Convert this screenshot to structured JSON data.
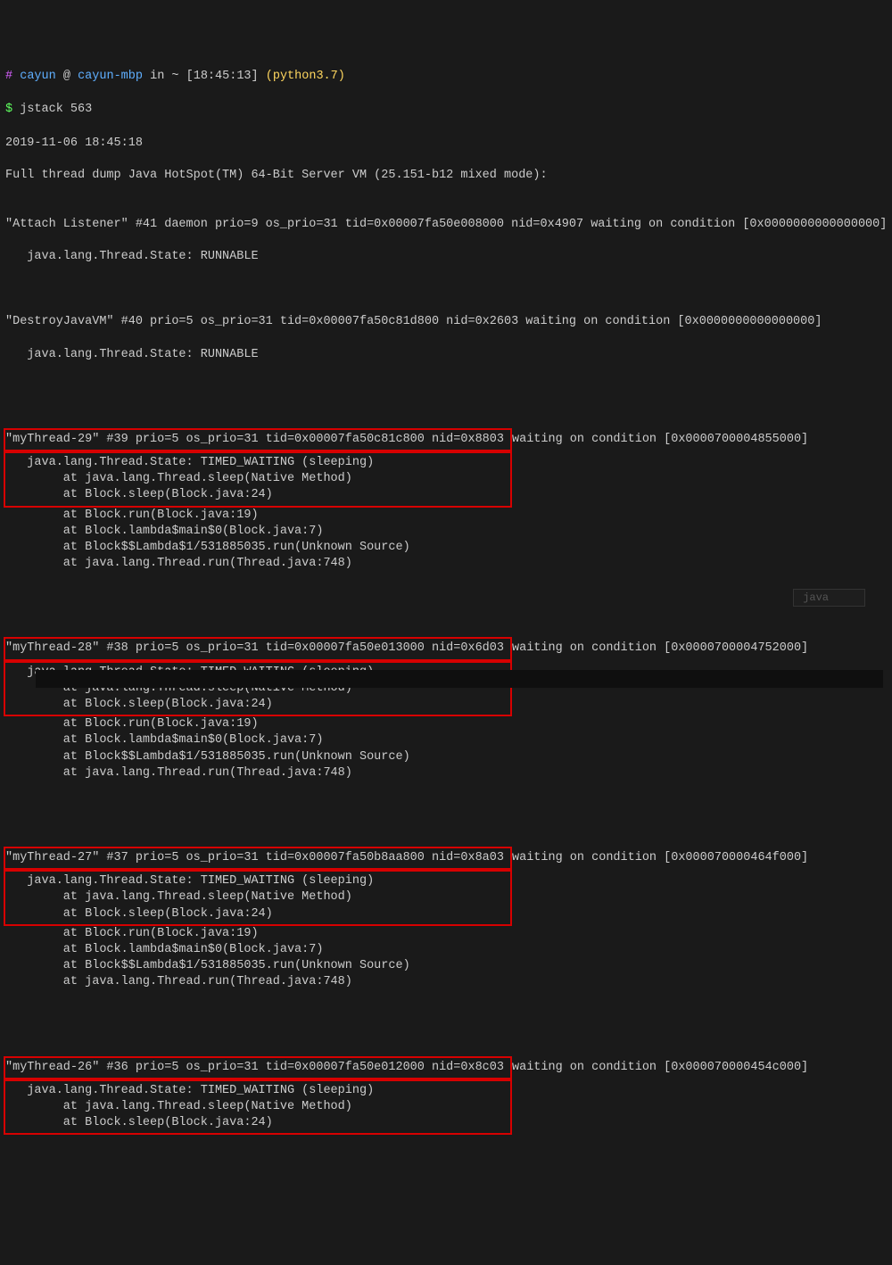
{
  "prompt": {
    "hash": "#",
    "user": "cayun",
    "at": "@",
    "host": "cayun-mbp",
    "in": "in",
    "path": "~",
    "time": "[18:45:13]",
    "python": "(python3.7)"
  },
  "command": {
    "dollar": "$",
    "text": "jstack 563"
  },
  "lines": {
    "l0": "2019-11-06 18:45:18",
    "l1": "Full thread dump Java HotSpot(TM) 64-Bit Server VM (25.151-b12 mixed mode):",
    "blank": "",
    "attach1": "\"Attach Listener\" #41 daemon prio=9 os_prio=31 tid=0x00007fa50e008000 nid=0x4907 waiting on condition [0x0000000000000000]",
    "attach2": "   java.lang.Thread.State: RUNNABLE",
    "destroy1": "\"DestroyJavaVM\" #40 prio=5 os_prio=31 tid=0x00007fa50c81d800 nid=0x2603 waiting on condition [0x0000000000000000]",
    "destroy2": "   java.lang.Thread.State: RUNNABLE",
    "t29_h_a": "\"myThread-29\" #39 prio=5 os_prio=31 tid=0x00007fa50c81c800 nid=0x8803 ",
    "t29_h_b": "waiting on condition [0x0000700004855000]",
    "t29_1": "   java.lang.Thread.State: TIMED_WAITING (sleeping)",
    "t29_2": "        at java.lang.Thread.sleep(Native Method)",
    "t29_3": "        at Block.sleep(Block.java:24)",
    "t29_4": "        at Block.run(Block.java:19)",
    "t29_5": "        at Block.lambda$main$0(Block.java:7)",
    "t29_6": "        at Block$$Lambda$1/531885035.run(Unknown Source)",
    "t29_7": "        at java.lang.Thread.run(Thread.java:748)",
    "t28_h_a": "\"myThread-28\" #38 prio=5 os_prio=31 tid=0x00007fa50e013000 nid=0x6d03 ",
    "t28_h_b": "waiting on condition [0x0000700004752000]",
    "t28_1": "   java.lang.Thread.State: TIMED_WAITING (sleeping)",
    "t28_2": "        at java.lang.Thread.sleep(Native Method)",
    "t28_3": "        at Block.sleep(Block.java:24)",
    "t28_4": "        at Block.run(Block.java:19)",
    "t28_5": "        at Block.lambda$main$0(Block.java:7)",
    "t28_6": "        at Block$$Lambda$1/531885035.run(Unknown Source)",
    "t28_7": "        at java.lang.Thread.run(Thread.java:748)",
    "t27_h_a": "\"myThread-27\" #37 prio=5 os_prio=31 tid=0x00007fa50b8aa800 nid=0x8a03 ",
    "t27_h_b": "waiting on condition [0x000070000464f000]",
    "t27_1": "   java.lang.Thread.State: TIMED_WAITING (sleeping)",
    "t27_2": "        at java.lang.Thread.sleep(Native Method)",
    "t27_3": "        at Block.sleep(Block.java:24)",
    "t27_4": "        at Block.run(Block.java:19)",
    "t27_5": "        at Block.lambda$main$0(Block.java:7)",
    "t27_6": "        at Block$$Lambda$1/531885035.run(Unknown Source)",
    "t27_7": "        at java.lang.Thread.run(Thread.java:748)",
    "t26_h_a": "\"myThread-26\" #36 prio=5 os_prio=31 tid=0x00007fa50e012000 nid=0x8c03 ",
    "t26_h_b": "waiting on condition [0x000070000454c000]",
    "t26_1": "   java.lang.Thread.State: TIMED_WAITING (sleeping)",
    "t26_2": "        at java.lang.Thread.sleep(Native Method)",
    "t26_3": "        at Block.sleep(Block.java:24)"
  },
  "ghost": {
    "tab": "java"
  }
}
